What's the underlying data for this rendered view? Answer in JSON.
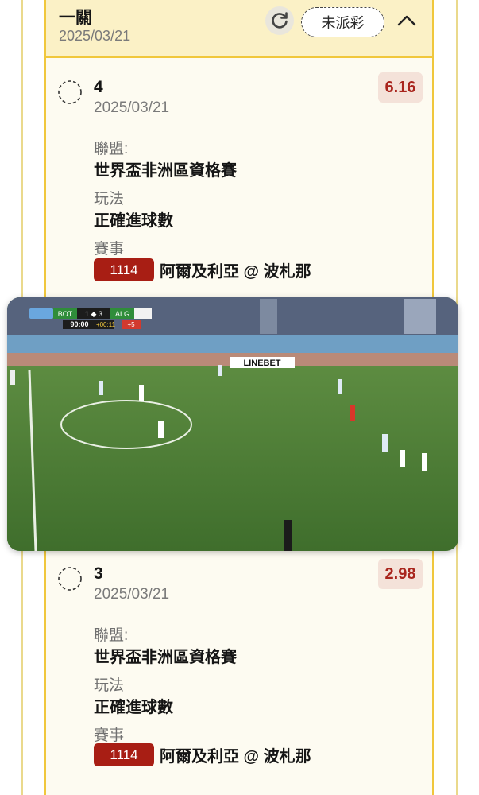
{
  "group": {
    "title": "一關",
    "date": "2025/03/21",
    "status": "未派彩",
    "refresh_icon": "refresh-icon",
    "collapse_icon": "chevron-up-icon"
  },
  "bets": [
    {
      "number": "4",
      "date": "2025/03/21",
      "odds": "6.16",
      "league_label": "聯盟:",
      "league": "世界盃非洲區資格賽",
      "play_label": "玩法",
      "play": "正確進球數",
      "event_label": "賽事",
      "match_id": "1114",
      "match_name": "阿爾及利亞 @ 波札那"
    },
    {
      "number": "3",
      "date": "2025/03/21",
      "odds": "2.98",
      "league_label": "聯盟:",
      "league": "世界盃非洲區資格賽",
      "play_label": "玩法",
      "play": "正確進球數",
      "event_label": "賽事",
      "match_id": "1114",
      "match_name": "阿爾及利亞 @ 波札那"
    }
  ],
  "video": {
    "home_abbr": "BOT",
    "score": "1 ◆ 3",
    "away_abbr": "ALG",
    "clock": "90:00",
    "extra_time": "+00:11",
    "added_minutes": "+5",
    "ad_board": "LINEBET"
  },
  "colors": {
    "accent_gold": "#f0c73c",
    "odds_red": "#a9251d",
    "badge_red": "#a81e14"
  }
}
